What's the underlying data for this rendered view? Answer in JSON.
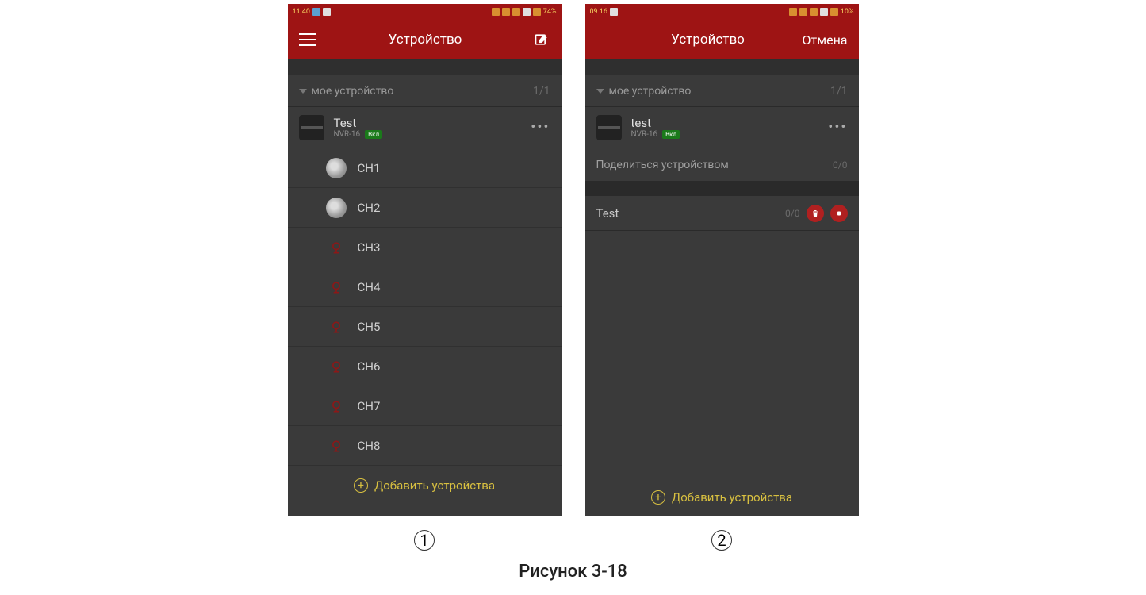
{
  "figure_caption": "Рисунок 3-18",
  "marker1": "1",
  "marker2": "2",
  "screen1": {
    "appbar": {
      "title": "Устройство"
    },
    "section": {
      "label": "мое устройство",
      "count": "1/1"
    },
    "device": {
      "name": "Test",
      "model": "NVR-16",
      "status": "Вкл"
    },
    "channels": [
      {
        "label": "CH1",
        "online": true
      },
      {
        "label": "CH2",
        "online": true
      },
      {
        "label": "CH3",
        "online": false
      },
      {
        "label": "CH4",
        "online": false
      },
      {
        "label": "CH5",
        "online": false
      },
      {
        "label": "CH6",
        "online": false
      },
      {
        "label": "CH7",
        "online": false
      },
      {
        "label": "CH8",
        "online": false
      }
    ],
    "add_label": "Добавить устройства"
  },
  "screen2": {
    "appbar": {
      "title": "Устройство",
      "cancel": "Отмена"
    },
    "section": {
      "label": "мое устройство",
      "count": "1/1"
    },
    "device": {
      "name": "test",
      "model": "NVR-16",
      "status": "Вкл"
    },
    "share": {
      "label": "Поделиться устройством",
      "count": "0/0"
    },
    "edit_item": {
      "name": "Test",
      "count": "0/0"
    },
    "add_label": "Добавить устройства"
  }
}
